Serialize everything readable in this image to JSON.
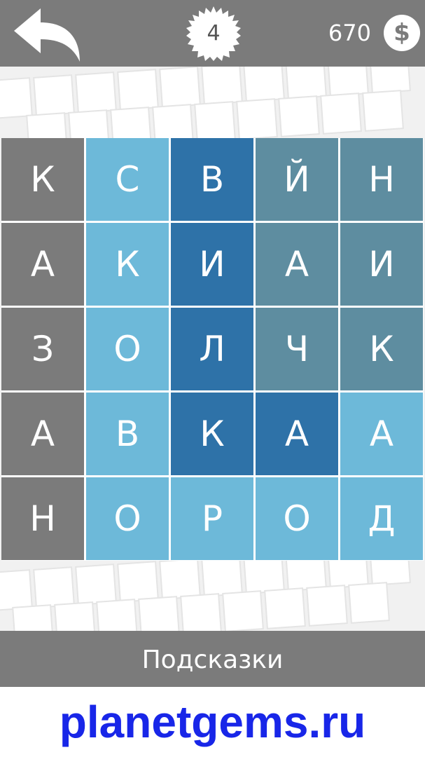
{
  "header": {
    "level": "4",
    "coins": "670",
    "coin_symbol": "$",
    "back_icon": "back-arrow-icon"
  },
  "grid": [
    [
      "К",
      "С",
      "В",
      "Й",
      "Н"
    ],
    [
      "А",
      "К",
      "И",
      "А",
      "И"
    ],
    [
      "З",
      "О",
      "Л",
      "Ч",
      "К"
    ],
    [
      "А",
      "В",
      "К",
      "А",
      "А"
    ],
    [
      "Н",
      "О",
      "Р",
      "О",
      "Д"
    ]
  ],
  "colors": {
    "gray": "#7b7b7b",
    "light_blue": "#6db9d9",
    "dark_blue": "#2e72a8",
    "slate": "#5e8da0"
  },
  "footer": {
    "hints_label": "Подсказки"
  },
  "watermark": "planetgems.ru"
}
